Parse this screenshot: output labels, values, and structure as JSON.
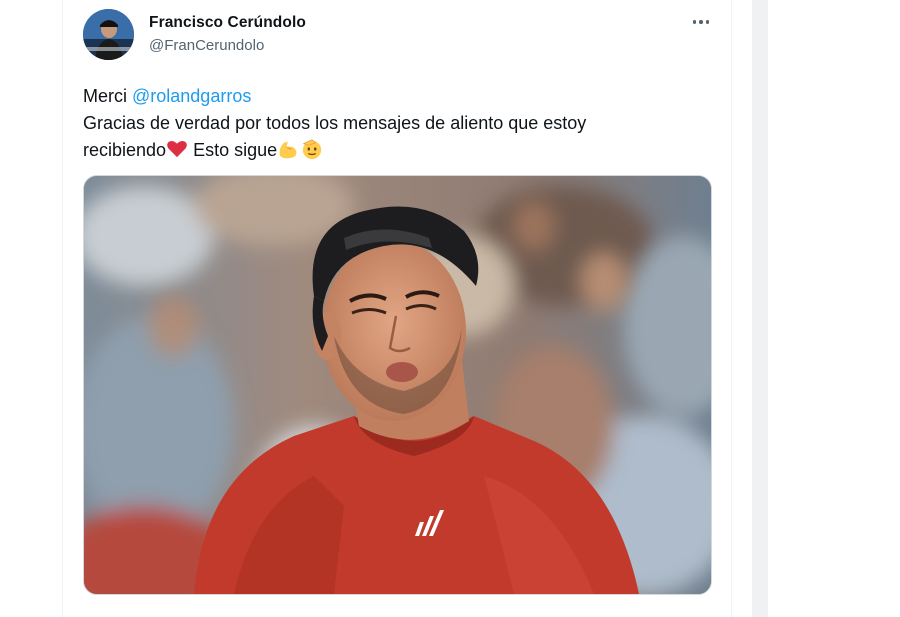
{
  "tweet": {
    "author": {
      "display_name": "Francisco Cerúndolo",
      "handle": "@FranCerundolo"
    },
    "text": {
      "line1_prefix": "Merci ",
      "mention": "@rolandgarros",
      "line2": "Gracias de verdad por todos los mensajes de aliento que estoy",
      "line3_part1": "recibiendo",
      "line3_part2": " Esto sigue"
    },
    "emojis": [
      "red-heart",
      "flexed-biceps",
      "saluting-face"
    ],
    "media": {
      "type": "photo",
      "subject": "tennis player in red shirt and black cap"
    },
    "more_icon": "ellipsis-icon"
  },
  "colors": {
    "text_primary": "#0f1419",
    "text_secondary": "#536471",
    "link": "#1d9bf0",
    "border": "#cfd9de"
  }
}
